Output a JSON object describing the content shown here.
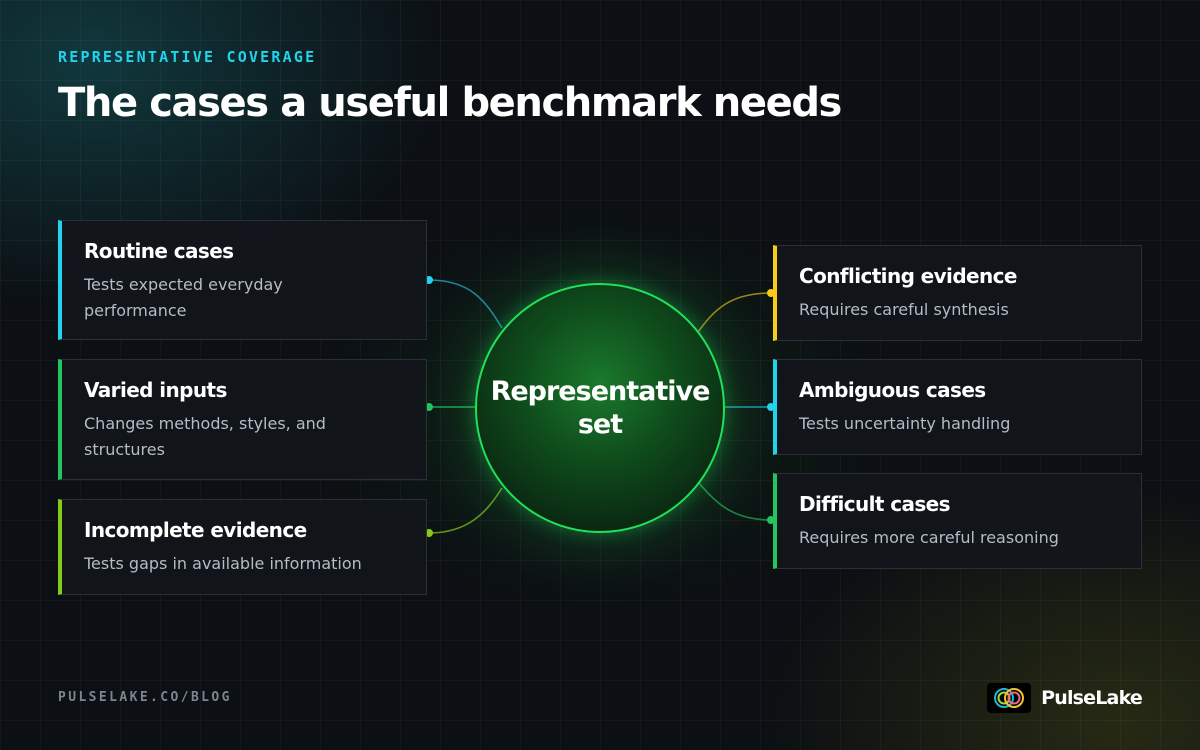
{
  "header": {
    "eyebrow": "REPRESENTATIVE COVERAGE",
    "title": "The cases a useful benchmark needs"
  },
  "hub": {
    "label": "Representative set",
    "color": "#22e05a"
  },
  "left_cards": [
    {
      "title": "Routine cases",
      "description": "Tests expected everyday performance",
      "accent": "#22d3ee"
    },
    {
      "title": "Varied inputs",
      "description": "Changes methods, styles, and structures",
      "accent": "#22c55e"
    },
    {
      "title": "Incomplete evidence",
      "description": "Tests gaps in available information",
      "accent": "#84cc16"
    }
  ],
  "right_cards": [
    {
      "title": "Conflicting evidence",
      "description": "Requires careful synthesis",
      "accent": "#facc15"
    },
    {
      "title": "Ambiguous cases",
      "description": "Tests uncertainty handling",
      "accent": "#22d3ee"
    },
    {
      "title": "Difficult cases",
      "description": "Requires more careful reasoning",
      "accent": "#22c55e"
    }
  ],
  "footer": {
    "url": "PULSELAKE.CO/BLOG",
    "brand": "PulseLake"
  }
}
